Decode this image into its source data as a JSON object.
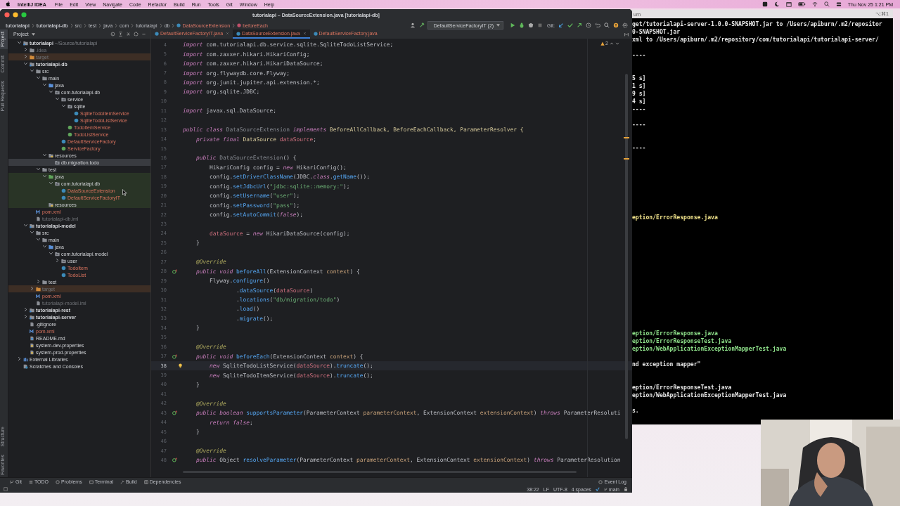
{
  "menu_bar": {
    "app": "IntelliJ IDEA",
    "items": [
      "File",
      "Edit",
      "View",
      "Navigate",
      "Code",
      "Refactor",
      "Build",
      "Run",
      "Tools",
      "Git",
      "Window",
      "Help"
    ],
    "clock": "Thu Nov 25  1:21 PM"
  },
  "window": {
    "title": "tutorialapi – DataSourceExtension.java [tutorialapi-db]"
  },
  "breadcrumbs": [
    {
      "label": "tutorialapi",
      "kind": "module"
    },
    {
      "label": "tutorialapi-db",
      "kind": "module"
    },
    {
      "label": "src",
      "kind": "folder"
    },
    {
      "label": "test",
      "kind": "folder"
    },
    {
      "label": "java",
      "kind": "folder"
    },
    {
      "label": "com",
      "kind": "folder"
    },
    {
      "label": "tutorialapi",
      "kind": "folder"
    },
    {
      "label": "db",
      "kind": "folder"
    },
    {
      "label": "DataSourceExtension",
      "kind": "class"
    },
    {
      "label": "beforeEach",
      "kind": "method"
    }
  ],
  "toolbar": {
    "run_config": "DefaultServiceFactoryIT (2)",
    "git_label": "Git:"
  },
  "tool_strip": [
    {
      "label": "Project",
      "selected": true
    },
    {
      "label": "Commit",
      "selected": false
    },
    {
      "label": "Pull Requests",
      "selected": false
    }
  ],
  "tool_strip_bottom": [
    {
      "label": "Structure",
      "selected": false
    },
    {
      "label": "Favorites",
      "selected": false
    }
  ],
  "project_panel": {
    "title": "Project"
  },
  "tree": [
    {
      "label": "tutorialapi",
      "hint": "~/Source/tutorialapi",
      "kind": "module",
      "expanded": true,
      "selected": false,
      "unversioned": false,
      "ignored": false,
      "excluded": false,
      "test": false,
      "children": [
        {
          "label": ".idea",
          "kind": "folder",
          "expanded": false,
          "selected": false,
          "unversioned": false,
          "ignored": true,
          "excluded": false,
          "test": false
        },
        {
          "label": "target",
          "kind": "excluded-folder",
          "expanded": false,
          "selected": false,
          "unversioned": false,
          "ignored": true,
          "excluded": true,
          "test": false
        },
        {
          "label": "tutorialapi-db",
          "kind": "module",
          "expanded": true,
          "selected": false,
          "unversioned": false,
          "ignored": false,
          "excluded": false,
          "test": false,
          "children": [
            {
              "label": "src",
              "kind": "folder",
              "expanded": true,
              "selected": false,
              "unversioned": false,
              "ignored": false,
              "excluded": false,
              "test": false,
              "children": [
                {
                  "label": "main",
                  "kind": "folder",
                  "expanded": true,
                  "selected": false,
                  "unversioned": false,
                  "ignored": false,
                  "excluded": false,
                  "test": false,
                  "children": [
                    {
                      "label": "java",
                      "kind": "source",
                      "expanded": true,
                      "selected": false,
                      "unversioned": false,
                      "ignored": false,
                      "excluded": false,
                      "test": false,
                      "children": [
                        {
                          "label": "com.tutorialapi.db",
                          "kind": "package",
                          "expanded": true,
                          "selected": false,
                          "unversioned": false,
                          "ignored": false,
                          "excluded": false,
                          "test": false,
                          "children": [
                            {
                              "label": "service",
                              "kind": "package",
                              "expanded": true,
                              "selected": false,
                              "unversioned": false,
                              "ignored": false,
                              "excluded": false,
                              "test": false,
                              "children": [
                                {
                                  "label": "sqlite",
                                  "kind": "package",
                                  "expanded": true,
                                  "selected": false,
                                  "unversioned": false,
                                  "ignored": false,
                                  "excluded": false,
                                  "test": false,
                                  "children": [
                                    {
                                      "label": "SqliteTodoItemService",
                                      "kind": "class",
                                      "selected": false,
                                      "unversioned": true,
                                      "ignored": false,
                                      "excluded": false,
                                      "test": false
                                    },
                                    {
                                      "label": "SqliteTodoListService",
                                      "kind": "class",
                                      "selected": false,
                                      "unversioned": true,
                                      "ignored": false,
                                      "excluded": false,
                                      "test": false
                                    }
                                  ]
                                },
                                {
                                  "label": "TodoItemService",
                                  "kind": "interface",
                                  "selected": false,
                                  "unversioned": true,
                                  "ignored": false,
                                  "excluded": false,
                                  "test": false
                                },
                                {
                                  "label": "TodoListService",
                                  "kind": "interface",
                                  "selected": false,
                                  "unversioned": true,
                                  "ignored": false,
                                  "excluded": false,
                                  "test": false
                                }
                              ]
                            },
                            {
                              "label": "DefaultServiceFactory",
                              "kind": "class",
                              "selected": false,
                              "unversioned": true,
                              "ignored": false,
                              "excluded": false,
                              "test": false
                            },
                            {
                              "label": "ServiceFactory",
                              "kind": "interface",
                              "selected": false,
                              "unversioned": true,
                              "ignored": false,
                              "excluded": false,
                              "test": false
                            }
                          ]
                        }
                      ]
                    },
                    {
                      "label": "resources",
                      "kind": "resources",
                      "expanded": true,
                      "selected": false,
                      "unversioned": false,
                      "ignored": false,
                      "excluded": false,
                      "test": false,
                      "children": [
                        {
                          "label": "db.migration.todo",
                          "kind": "package",
                          "selected": true,
                          "unversioned": false,
                          "ignored": false,
                          "excluded": false,
                          "test": false
                        }
                      ]
                    }
                  ]
                },
                {
                  "label": "test",
                  "kind": "folder",
                  "expanded": true,
                  "selected": false,
                  "unversioned": false,
                  "ignored": false,
                  "excluded": false,
                  "test": false,
                  "children": [
                    {
                      "label": "java",
                      "kind": "test-source",
                      "expanded": true,
                      "selected": false,
                      "unversioned": false,
                      "ignored": false,
                      "excluded": false,
                      "test": true,
                      "children": [
                        {
                          "label": "com.tutorialapi.db",
                          "kind": "package",
                          "expanded": true,
                          "selected": false,
                          "unversioned": false,
                          "ignored": false,
                          "excluded": false,
                          "test": true,
                          "children": [
                            {
                              "label": "DataSourceExtension",
                              "kind": "class",
                              "selected": false,
                              "unversioned": true,
                              "ignored": false,
                              "excluded": false,
                              "test": true
                            },
                            {
                              "label": "DefaultServiceFactoryIT",
                              "kind": "class",
                              "selected": false,
                              "unversioned": true,
                              "ignored": false,
                              "excluded": false,
                              "test": true
                            }
                          ]
                        }
                      ]
                    },
                    {
                      "label": "resources",
                      "kind": "resources",
                      "selected": false,
                      "unversioned": false,
                      "ignored": false,
                      "excluded": false,
                      "test": true
                    }
                  ]
                }
              ]
            },
            {
              "label": "pom.xml",
              "kind": "maven",
              "selected": false,
              "unversioned": true,
              "ignored": false,
              "excluded": false,
              "test": false
            },
            {
              "label": "tutorialapi-db.iml",
              "kind": "file",
              "selected": false,
              "unversioned": false,
              "ignored": true,
              "excluded": false,
              "test": false
            }
          ]
        },
        {
          "label": "tutorialapi-model",
          "kind": "module",
          "expanded": true,
          "selected": false,
          "unversioned": false,
          "ignored": false,
          "excluded": false,
          "test": false,
          "children": [
            {
              "label": "src",
              "kind": "folder",
              "expanded": true,
              "selected": false,
              "unversioned": false,
              "ignored": false,
              "excluded": false,
              "test": false,
              "children": [
                {
                  "label": "main",
                  "kind": "folder",
                  "expanded": true,
                  "selected": false,
                  "unversioned": false,
                  "ignored": false,
                  "excluded": false,
                  "test": false,
                  "children": [
                    {
                      "label": "java",
                      "kind": "source",
                      "expanded": true,
                      "selected": false,
                      "unversioned": false,
                      "ignored": false,
                      "excluded": false,
                      "test": false,
                      "children": [
                        {
                          "label": "com.tutorialapi.model",
                          "kind": "package",
                          "expanded": true,
                          "selected": false,
                          "unversioned": false,
                          "ignored": false,
                          "excluded": false,
                          "test": false,
                          "children": [
                            {
                              "label": "user",
                              "kind": "package",
                              "expanded": false,
                              "selected": false,
                              "unversioned": false,
                              "ignored": false,
                              "excluded": false,
                              "test": false
                            },
                            {
                              "label": "TodoItem",
                              "kind": "class",
                              "selected": false,
                              "unversioned": true,
                              "ignored": false,
                              "excluded": false,
                              "test": false
                            },
                            {
                              "label": "TodoList",
                              "kind": "class",
                              "selected": false,
                              "unversioned": true,
                              "ignored": false,
                              "excluded": false,
                              "test": false
                            }
                          ]
                        }
                      ]
                    }
                  ]
                },
                {
                  "label": "test",
                  "kind": "folder",
                  "expanded": false,
                  "selected": false,
                  "unversioned": false,
                  "ignored": false,
                  "excluded": false,
                  "test": false
                }
              ]
            },
            {
              "label": "target",
              "kind": "excluded-folder",
              "expanded": false,
              "selected": false,
              "unversioned": false,
              "ignored": true,
              "excluded": true,
              "test": false
            },
            {
              "label": "pom.xml",
              "kind": "maven",
              "selected": false,
              "unversioned": true,
              "ignored": false,
              "excluded": false,
              "test": false
            },
            {
              "label": "tutorialapi-model.iml",
              "kind": "file",
              "selected": false,
              "unversioned": false,
              "ignored": true,
              "excluded": false,
              "test": false
            }
          ]
        },
        {
          "label": "tutorialapi-rest",
          "kind": "module",
          "expanded": false,
          "selected": false,
          "unversioned": false,
          "ignored": false,
          "excluded": false,
          "test": false
        },
        {
          "label": "tutorialapi-server",
          "kind": "module",
          "expanded": false,
          "selected": false,
          "unversioned": false,
          "ignored": false,
          "excluded": false,
          "test": false
        },
        {
          "label": ".gitignore",
          "kind": "file",
          "selected": false,
          "unversioned": false,
          "ignored": false,
          "excluded": false,
          "test": false
        },
        {
          "label": "pom.xml",
          "kind": "maven",
          "selected": false,
          "unversioned": true,
          "ignored": false,
          "excluded": false,
          "test": false
        },
        {
          "label": "README.md",
          "kind": "markdown",
          "selected": false,
          "unversioned": false,
          "ignored": false,
          "excluded": false,
          "test": false
        },
        {
          "label": "system-dev.properties",
          "kind": "properties",
          "selected": false,
          "unversioned": false,
          "ignored": false,
          "excluded": false,
          "test": false
        },
        {
          "label": "system-prod.properties",
          "kind": "properties",
          "selected": false,
          "unversioned": false,
          "ignored": false,
          "excluded": false,
          "test": false
        }
      ]
    },
    {
      "label": "External Libraries",
      "kind": "libraries",
      "expanded": false,
      "selected": false,
      "unversioned": false,
      "ignored": false,
      "excluded": false,
      "test": false
    },
    {
      "label": "Scratches and Consoles",
      "kind": "scratches",
      "selected": false,
      "unversioned": false,
      "ignored": false,
      "excluded": false,
      "test": false
    }
  ],
  "tabs": [
    {
      "label": "DefaultServiceFactoryIT.java",
      "selected": false,
      "closable": true,
      "unversioned": true
    },
    {
      "label": "DataSourceExtension.java",
      "selected": true,
      "closable": true,
      "unversioned": true
    },
    {
      "label": "DefaultServiceFactory.java",
      "selected": false,
      "closable": false,
      "unversioned": true
    }
  ],
  "editor": {
    "warnings": "2",
    "lines": [
      {
        "number": "4",
        "current": false,
        "tokens": [
          {
            "text": "import ",
            "kind": "kw"
          },
          {
            "text": "com.tutorialapi.db.service.sqlite.SqliteTodoListService;",
            "kind": "plain"
          }
        ]
      },
      {
        "number": "5",
        "current": false,
        "tokens": [
          {
            "text": "import ",
            "kind": "kw"
          },
          {
            "text": "com.zaxxer.hikari.HikariConfig;",
            "kind": "plain"
          }
        ]
      },
      {
        "number": "6",
        "current": false,
        "tokens": [
          {
            "text": "import ",
            "kind": "kw"
          },
          {
            "text": "com.zaxxer.hikari.HikariDataSource;",
            "kind": "plain"
          }
        ]
      },
      {
        "number": "7",
        "current": false,
        "tokens": [
          {
            "text": "import ",
            "kind": "kw"
          },
          {
            "text": "org.flywaydb.core.Flyway;",
            "kind": "plain"
          }
        ]
      },
      {
        "number": "8",
        "current": false,
        "tokens": [
          {
            "text": "import ",
            "kind": "kw"
          },
          {
            "text": "org.junit.jupiter.api.extension.*;",
            "kind": "plain"
          }
        ]
      },
      {
        "number": "9",
        "current": false,
        "tokens": [
          {
            "text": "import ",
            "kind": "kw"
          },
          {
            "text": "org.sqlite.JDBC;",
            "kind": "plain"
          }
        ]
      },
      {
        "number": "10",
        "current": false
      },
      {
        "number": "11",
        "current": false,
        "tokens": [
          {
            "text": "import ",
            "kind": "kw"
          },
          {
            "text": "javax.sql.DataSource;",
            "kind": "plain"
          }
        ]
      },
      {
        "number": "12",
        "current": false
      },
      {
        "number": "13",
        "current": false,
        "tokens": [
          {
            "text": "public class ",
            "kind": "kw"
          },
          {
            "text": "DataSourceExtension ",
            "kind": "unused"
          },
          {
            "text": "implements ",
            "kind": "kw"
          },
          {
            "text": "BeforeAllCallback, BeforeEachCallback, ParameterResolver {",
            "kind": "type"
          }
        ]
      },
      {
        "number": "14",
        "current": false,
        "tokens": [
          {
            "text": "    private final ",
            "kind": "kw"
          },
          {
            "text": "DataSource ",
            "kind": "type"
          },
          {
            "text": "dataSource",
            "kind": "field"
          },
          {
            "text": ";",
            "kind": "plain"
          }
        ]
      },
      {
        "number": "15",
        "current": false
      },
      {
        "number": "16",
        "current": false,
        "tokens": [
          {
            "text": "    public ",
            "kind": "kw"
          },
          {
            "text": "DataSourceExtension",
            "kind": "unused"
          },
          {
            "text": "() {",
            "kind": "plain"
          }
        ]
      },
      {
        "number": "17",
        "current": false,
        "tokens": [
          {
            "text": "        HikariConfig config = ",
            "kind": "plain"
          },
          {
            "text": "new ",
            "kind": "kw"
          },
          {
            "text": "HikariConfig();",
            "kind": "plain"
          }
        ]
      },
      {
        "number": "18",
        "current": false,
        "tokens": [
          {
            "text": "        config.",
            "kind": "plain"
          },
          {
            "text": "setDriverClassName",
            "kind": "method"
          },
          {
            "text": "(JDBC.",
            "kind": "plain"
          },
          {
            "text": "class",
            "kind": "kw"
          },
          {
            "text": ".",
            "kind": "plain"
          },
          {
            "text": "getName",
            "kind": "method"
          },
          {
            "text": "());",
            "kind": "plain"
          }
        ]
      },
      {
        "number": "19",
        "current": false,
        "tokens": [
          {
            "text": "        config.",
            "kind": "plain"
          },
          {
            "text": "setJdbcUrl",
            "kind": "method"
          },
          {
            "text": "(",
            "kind": "plain"
          },
          {
            "text": "\"jdbc:sqlite::memory:\"",
            "kind": "string"
          },
          {
            "text": ");",
            "kind": "plain"
          }
        ]
      },
      {
        "number": "20",
        "current": false,
        "tokens": [
          {
            "text": "        config.",
            "kind": "plain"
          },
          {
            "text": "setUsername",
            "kind": "method"
          },
          {
            "text": "(",
            "kind": "plain"
          },
          {
            "text": "\"user\"",
            "kind": "string"
          },
          {
            "text": ");",
            "kind": "plain"
          }
        ]
      },
      {
        "number": "21",
        "current": false,
        "tokens": [
          {
            "text": "        config.",
            "kind": "plain"
          },
          {
            "text": "setPassword",
            "kind": "method"
          },
          {
            "text": "(",
            "kind": "plain"
          },
          {
            "text": "\"pass\"",
            "kind": "string"
          },
          {
            "text": ");",
            "kind": "plain"
          }
        ]
      },
      {
        "number": "22",
        "current": false,
        "tokens": [
          {
            "text": "        config.",
            "kind": "plain"
          },
          {
            "text": "setAutoCommit",
            "kind": "method"
          },
          {
            "text": "(",
            "kind": "plain"
          },
          {
            "text": "false",
            "kind": "kw"
          },
          {
            "text": ");",
            "kind": "plain"
          }
        ]
      },
      {
        "number": "23",
        "current": false
      },
      {
        "number": "24",
        "current": false,
        "tokens": [
          {
            "text": "        dataSource",
            "kind": "field"
          },
          {
            "text": " = ",
            "kind": "plain"
          },
          {
            "text": "new ",
            "kind": "kw"
          },
          {
            "text": "HikariDataSource(config);",
            "kind": "plain"
          }
        ]
      },
      {
        "number": "25",
        "current": false,
        "tokens": [
          {
            "text": "    }",
            "kind": "plain"
          }
        ]
      },
      {
        "number": "26",
        "current": false
      },
      {
        "number": "27",
        "current": false,
        "tokens": [
          {
            "text": "    @Override",
            "kind": "annotation"
          }
        ]
      },
      {
        "number": "28",
        "current": false,
        "kind": "override",
        "tokens": [
          {
            "text": "    public void ",
            "kind": "kw"
          },
          {
            "text": "beforeAll",
            "kind": "method"
          },
          {
            "text": "(ExtensionContext ",
            "kind": "plain"
          },
          {
            "text": "context",
            "kind": "param"
          },
          {
            "text": ") {",
            "kind": "plain"
          }
        ]
      },
      {
        "number": "29",
        "current": false,
        "tokens": [
          {
            "text": "        Flyway.",
            "kind": "plain"
          },
          {
            "text": "configure",
            "kind": "method"
          },
          {
            "text": "()",
            "kind": "plain"
          }
        ]
      },
      {
        "number": "30",
        "current": false,
        "tokens": [
          {
            "text": "                .",
            "kind": "plain"
          },
          {
            "text": "dataSource",
            "kind": "method"
          },
          {
            "text": "(",
            "kind": "plain"
          },
          {
            "text": "dataSource",
            "kind": "field"
          },
          {
            "text": ")",
            "kind": "plain"
          }
        ]
      },
      {
        "number": "31",
        "current": false,
        "tokens": [
          {
            "text": "                .",
            "kind": "plain"
          },
          {
            "text": "locations",
            "kind": "method"
          },
          {
            "text": "(",
            "kind": "plain"
          },
          {
            "text": "\"db/migration/todo\"",
            "kind": "string"
          },
          {
            "text": ")",
            "kind": "plain"
          }
        ]
      },
      {
        "number": "32",
        "current": false,
        "tokens": [
          {
            "text": "                .",
            "kind": "plain"
          },
          {
            "text": "load",
            "kind": "method"
          },
          {
            "text": "()",
            "kind": "plain"
          }
        ]
      },
      {
        "number": "33",
        "current": false,
        "tokens": [
          {
            "text": "                .",
            "kind": "plain"
          },
          {
            "text": "migrate",
            "kind": "method"
          },
          {
            "text": "();",
            "kind": "plain"
          }
        ]
      },
      {
        "number": "34",
        "current": false,
        "tokens": [
          {
            "text": "    }",
            "kind": "plain"
          }
        ]
      },
      {
        "number": "35",
        "current": false
      },
      {
        "number": "36",
        "current": false,
        "tokens": [
          {
            "text": "    @Override",
            "kind": "annotation"
          }
        ]
      },
      {
        "number": "37",
        "current": false,
        "kind": "override",
        "tokens": [
          {
            "text": "    public void ",
            "kind": "kw"
          },
          {
            "text": "beforeEach",
            "kind": "method"
          },
          {
            "text": "(ExtensionContext ",
            "kind": "plain"
          },
          {
            "text": "context",
            "kind": "param"
          },
          {
            "text": ") {",
            "kind": "plain"
          }
        ]
      },
      {
        "number": "38",
        "current": true,
        "kind": "bulb",
        "tokens": [
          {
            "text": "        new ",
            "kind": "kw"
          },
          {
            "text": "SqliteTodoListService(",
            "kind": "plain"
          },
          {
            "text": "dataSource",
            "kind": "field"
          },
          {
            "text": ").",
            "kind": "plain"
          },
          {
            "text": "truncate",
            "kind": "method"
          },
          {
            "text": "();",
            "kind": "plain"
          }
        ]
      },
      {
        "number": "39",
        "current": false,
        "tokens": [
          {
            "text": "        new ",
            "kind": "kw"
          },
          {
            "text": "SqliteTodoItemService(",
            "kind": "plain"
          },
          {
            "text": "dataSource",
            "kind": "field"
          },
          {
            "text": ").",
            "kind": "plain"
          },
          {
            "text": "truncate",
            "kind": "method"
          },
          {
            "text": "();",
            "kind": "plain"
          }
        ]
      },
      {
        "number": "40",
        "current": false,
        "tokens": [
          {
            "text": "    }",
            "kind": "plain"
          }
        ]
      },
      {
        "number": "41",
        "current": false
      },
      {
        "number": "42",
        "current": false,
        "tokens": [
          {
            "text": "    @Override",
            "kind": "annotation"
          }
        ]
      },
      {
        "number": "43",
        "current": false,
        "kind": "override",
        "tokens": [
          {
            "text": "    public boolean ",
            "kind": "kw"
          },
          {
            "text": "supportsParameter",
            "kind": "method"
          },
          {
            "text": "(ParameterContext ",
            "kind": "plain"
          },
          {
            "text": "parameterContext",
            "kind": "param"
          },
          {
            "text": ", ExtensionContext ",
            "kind": "plain"
          },
          {
            "text": "extensionContext",
            "kind": "param"
          },
          {
            "text": ") ",
            "kind": "plain"
          },
          {
            "text": "throws ",
            "kind": "kw"
          },
          {
            "text": "ParameterResoluti",
            "kind": "plain"
          }
        ]
      },
      {
        "number": "44",
        "current": false,
        "tokens": [
          {
            "text": "        return false",
            "kind": "kw"
          },
          {
            "text": ";",
            "kind": "plain"
          }
        ]
      },
      {
        "number": "45",
        "current": false,
        "tokens": [
          {
            "text": "    }",
            "kind": "plain"
          }
        ]
      },
      {
        "number": "46",
        "current": false
      },
      {
        "number": "47",
        "current": false,
        "tokens": [
          {
            "text": "    @Override",
            "kind": "annotation"
          }
        ]
      },
      {
        "number": "48",
        "current": false,
        "kind": "override",
        "tokens": [
          {
            "text": "    public ",
            "kind": "kw"
          },
          {
            "text": "Object ",
            "kind": "plain"
          },
          {
            "text": "resolveParameter",
            "kind": "method"
          },
          {
            "text": "(ParameterContext ",
            "kind": "plain"
          },
          {
            "text": "parameterContext",
            "kind": "param"
          },
          {
            "text": ", ExtensionContext ",
            "kind": "plain"
          },
          {
            "text": "extensionContext",
            "kind": "param"
          },
          {
            "text": ") ",
            "kind": "plain"
          },
          {
            "text": "throws ",
            "kind": "kw"
          },
          {
            "text": "ParameterResolution",
            "kind": "plain"
          }
        ]
      }
    ]
  },
  "tool_windows": [
    {
      "label": "Git",
      "kind": "git"
    },
    {
      "label": "TODO",
      "kind": "list"
    },
    {
      "label": "Problems",
      "kind": "problems"
    },
    {
      "label": "Terminal",
      "kind": "terminal"
    },
    {
      "label": "Build",
      "kind": "hammer"
    },
    {
      "label": "Dependencies",
      "kind": "deps"
    }
  ],
  "event_log": "Event Log",
  "status_bar": {
    "position": "38:22",
    "line_separator": "LF",
    "encoding": "UTF-8",
    "indent": "4 spaces",
    "branch": "main"
  },
  "terminal": {
    "title": "urn",
    "shortcut": "⌥⌘1",
    "lines": [
      {
        "text": "get/tutorialapi-server-1.0.0-SNAPSHOT.jar to /Users/apiburn/.m2/repositor",
        "color": "#e6e6e6"
      },
      {
        "text": "0-SNAPSHOT.jar",
        "color": "#e6e6e6"
      },
      {
        "text": "xml to /Users/apiburn/.m2/repository/com/tutorialapi/tutorialapi-server/",
        "color": "#e6e6e6"
      },
      {
        "text": "----",
        "color": "#e6e6e6"
      },
      {
        "text": "5 s]",
        "color": "#e6e6e6"
      },
      {
        "text": "1 s]",
        "color": "#e6e6e6"
      },
      {
        "text": "9 s]",
        "color": "#e6e6e6"
      },
      {
        "text": "4 s]",
        "color": "#e6e6e6"
      },
      {
        "text": "----",
        "color": "#e6e6e6"
      },
      {
        "text": "----",
        "color": "#e6e6e6"
      },
      {
        "text": "----",
        "color": "#e6e6e6"
      },
      {
        "text": "eption/ErrorResponse.java",
        "color": "#f2e48c"
      },
      {
        "text": "eption/ErrorResponse.java",
        "color": "#8ee08a"
      },
      {
        "text": "eption/ErrorResponseTest.java",
        "color": "#8ee08a"
      },
      {
        "text": "eption/WebApplicationExceptionMapperTest.java",
        "color": "#8ee08a"
      },
      {
        "text": "nd exception mapper\"",
        "color": "#e6e6e6"
      },
      {
        "text": "eption/ErrorResponseTest.java",
        "color": "#e6e6e6"
      },
      {
        "text": "eption/WebApplicationExceptionMapperTest.java",
        "color": "#e6e6e6"
      },
      {
        "text": "s.",
        "color": "#e6e6e6"
      }
    ]
  }
}
